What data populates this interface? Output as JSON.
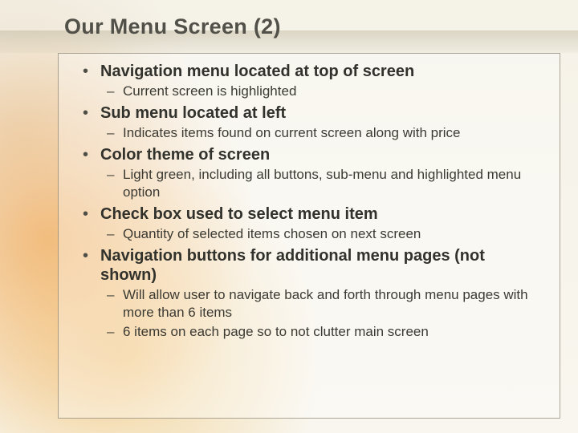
{
  "title": "Our Menu Screen (2)",
  "bullets": [
    {
      "text": "Navigation menu located at top of screen",
      "subs": [
        "Current screen is highlighted"
      ]
    },
    {
      "text": "Sub menu located at left",
      "subs": [
        "Indicates items found on current screen along with price"
      ]
    },
    {
      "text": "Color theme of screen",
      "subs": [
        "Light green, including all buttons, sub-menu and highlighted menu option"
      ]
    },
    {
      "text": "Check box used to select menu item",
      "subs": [
        "Quantity of selected items chosen on next screen"
      ]
    },
    {
      "text": "Navigation buttons for additional menu pages (not shown)",
      "subs": [
        "Will allow user to navigate back and forth through menu pages with more than 6 items",
        "6 items on each page so to not clutter main screen"
      ]
    }
  ]
}
